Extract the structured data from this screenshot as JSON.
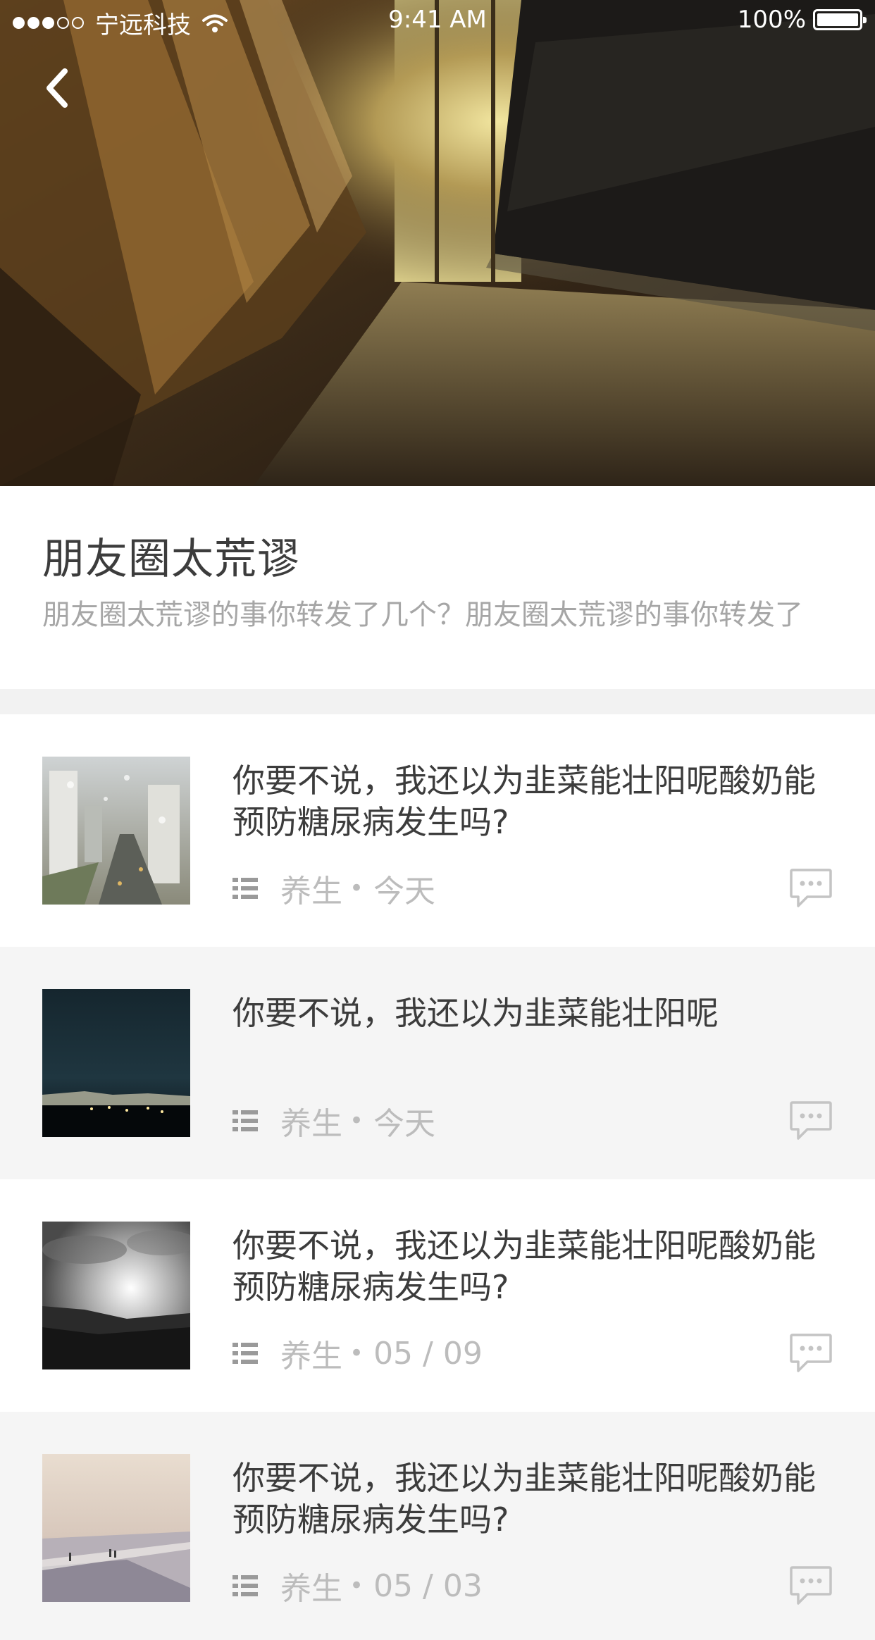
{
  "status_bar": {
    "carrier": "宁远科技",
    "time": "9:41 AM",
    "battery": "100%",
    "signal_icon": "signal-dots-icon",
    "wifi_icon": "wifi-icon",
    "battery_icon": "battery-icon"
  },
  "nav": {
    "back_icon": "chevron-left-icon"
  },
  "intro": {
    "title": "朋友圈太荒谬",
    "description": "朋友圈太荒谬的事你转发了几个？朋友圈太荒谬的事你转发了"
  },
  "articles": [
    {
      "title": "你要不说，我还以为韭菜能壮阳呢酸奶能预防糖尿病发生吗?",
      "category": "养生",
      "separator": "•",
      "date": "今天"
    },
    {
      "title": "你要不说，我还以为韭菜能壮阳呢",
      "category": "养生",
      "separator": "•",
      "date": "今天"
    },
    {
      "title": "你要不说，我还以为韭菜能壮阳呢酸奶能预防糖尿病发生吗?",
      "category": "养生",
      "separator": "•",
      "date": "05 / 09"
    },
    {
      "title": "你要不说，我还以为韭菜能壮阳呢酸奶能预防糖尿病发生吗?",
      "category": "养生",
      "separator": "•",
      "date": "05 / 03"
    }
  ],
  "colors": {
    "title_text": "#3c3c3c",
    "meta_text": "#bcbcbc",
    "alt_row_bg": "#f5f5f5",
    "separator_bg": "#f2f2f2"
  }
}
